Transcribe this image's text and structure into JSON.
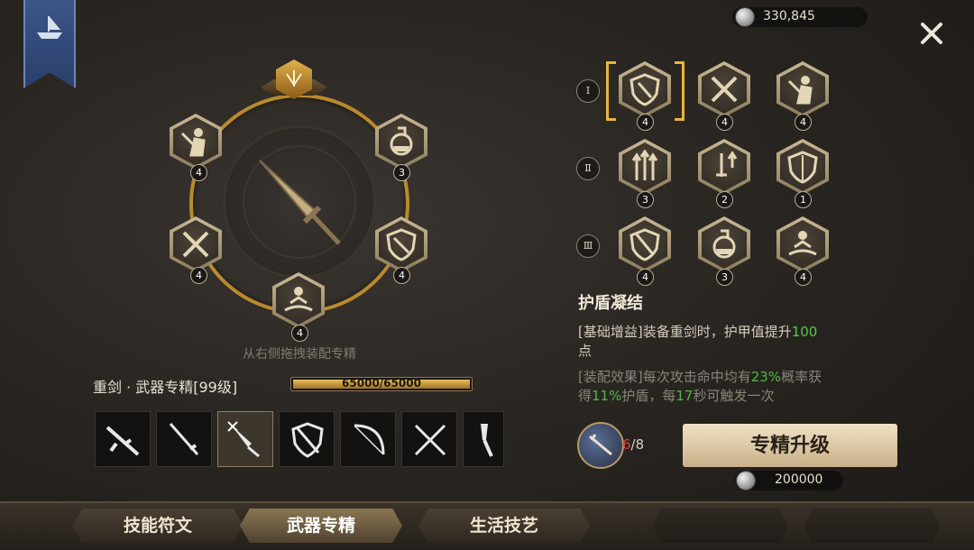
{
  "currency": {
    "balance": "330,845",
    "icon": "silver-coin-icon"
  },
  "wheel": {
    "hint": "从右侧拖拽装配专精",
    "slots": [
      {
        "icon": "fighter-icon",
        "level": "4"
      },
      {
        "icon": "potion-icon",
        "level": "3"
      },
      {
        "icon": "crossed-swords-icon",
        "level": "4"
      },
      {
        "icon": "shield-icon",
        "level": "4"
      },
      {
        "icon": "splash-icon",
        "level": "4"
      }
    ]
  },
  "weapon": {
    "label": "重剑 · 武器专精[99级]",
    "xp_text": "65000/65000",
    "xp_progress": 1.0,
    "types": [
      "rifle-icon",
      "katana-icon",
      "greatsword-icon",
      "shield-sword-icon",
      "bow-icon",
      "dual-swords-icon",
      "dagger-icon"
    ],
    "selected_index": 2
  },
  "tiers": [
    {
      "numeral": "Ⅰ",
      "skills": [
        {
          "icon": "shield-icon",
          "level": "4"
        },
        {
          "icon": "crossed-swords-icon",
          "level": "4"
        },
        {
          "icon": "fighter-icon",
          "level": "4"
        }
      ]
    },
    {
      "numeral": "Ⅱ",
      "skills": [
        {
          "icon": "triple-arrow-icon",
          "level": "3"
        },
        {
          "icon": "sword-up-icon",
          "level": "2"
        },
        {
          "icon": "shield-icon",
          "level": "1"
        }
      ]
    },
    {
      "numeral": "Ⅲ",
      "skills": [
        {
          "icon": "shield-icon",
          "level": "4"
        },
        {
          "icon": "potion-icon",
          "level": "3"
        },
        {
          "icon": "splash-icon",
          "level": "4"
        }
      ]
    }
  ],
  "detail": {
    "title": "护盾凝结",
    "line1_a": "[基础增益]装备重剑时，护甲值提升",
    "line1_b": "100",
    "line1_c": "点",
    "line2_a": "[装配效果]每次攻击命中均有",
    "line2_b": "23%",
    "line2_c": "概率获",
    "line3_a": "得",
    "line3_b": "11%",
    "line3_c": "护盾，每",
    "line3_d": "17",
    "line3_e": "秒可触发一次"
  },
  "upgrade": {
    "books_have": "6",
    "books_sep": "/8",
    "button": "专精升级",
    "cost": "200000"
  },
  "tabs": [
    "技能符文",
    "武器专精",
    "生活技艺"
  ],
  "colors": {
    "accent_gold": "#e7b63a",
    "highlight_green": "#58c74a",
    "warning_red": "#e0403a"
  }
}
